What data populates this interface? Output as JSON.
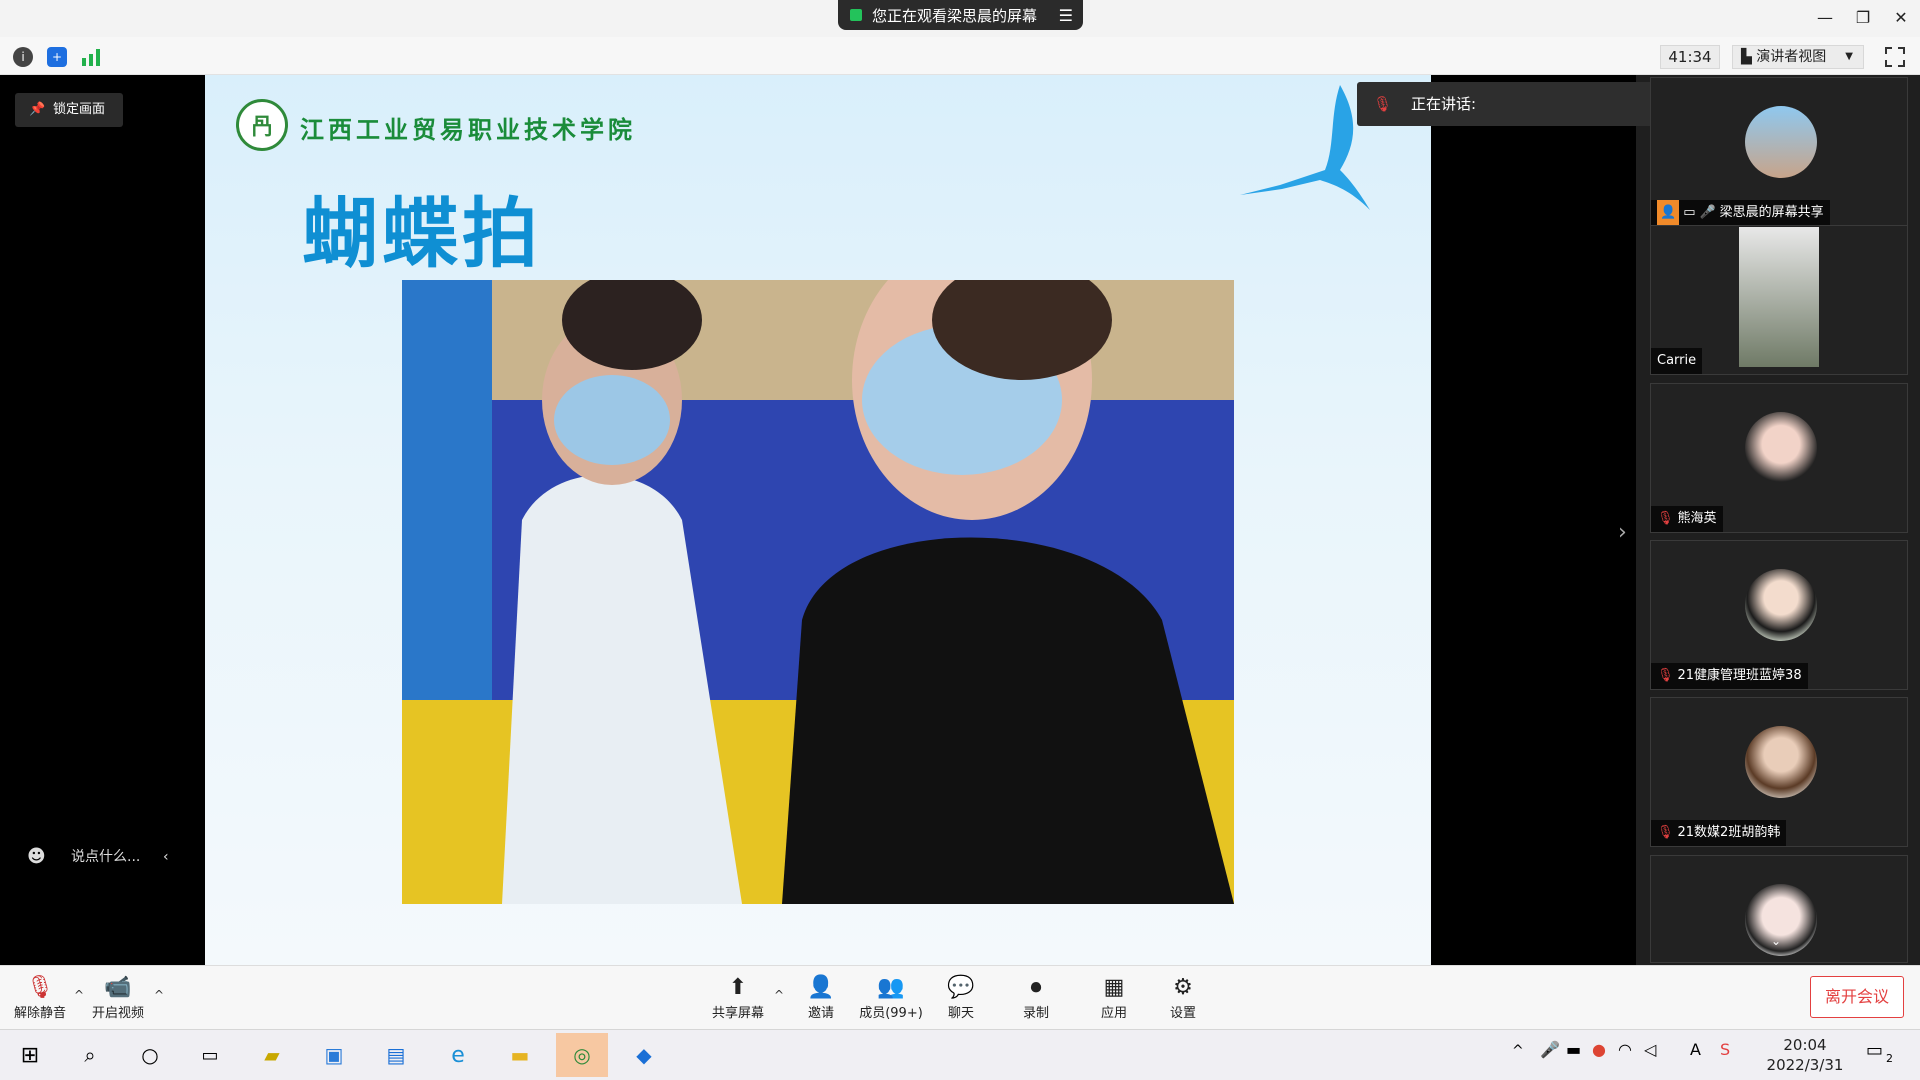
{
  "window": {
    "share_notice": "您正在观看梁思晨的屏幕",
    "minimize": "—",
    "restore": "❐",
    "close": "✕"
  },
  "topbar": {
    "timer": "41:34",
    "view_label": "演讲者视图"
  },
  "left": {
    "lock_label": "锁定画面",
    "chat_placeholder": "说点什么..."
  },
  "slide": {
    "college_name": "江西工业贸易职业技术学院",
    "title": "蝴蝶拍"
  },
  "speaking": {
    "label": "正在讲话:"
  },
  "participants": [
    {
      "name": "梁思晨的屏幕共享"
    },
    {
      "name": "Carrie"
    },
    {
      "name": "熊海英"
    },
    {
      "name": "21健康管理班蓝婷38"
    },
    {
      "name": "21数媒2班胡韵韩"
    },
    {
      "name": ""
    }
  ],
  "bottombar": {
    "unmute": "解除静音",
    "start_video": "开启视频",
    "share_screen": "共享屏幕",
    "invite": "邀请",
    "members": "成员(99+)",
    "chat": "聊天",
    "record": "录制",
    "apps": "应用",
    "settings": "设置",
    "leave": "离开会议"
  },
  "taskbar": {
    "time": "20:04",
    "date": "2022/3/31",
    "notification_count": "2"
  },
  "colors": {
    "accent_blue": "#0f8fd3",
    "leave_red": "#e34040",
    "college_green": "#1a8c3a"
  }
}
